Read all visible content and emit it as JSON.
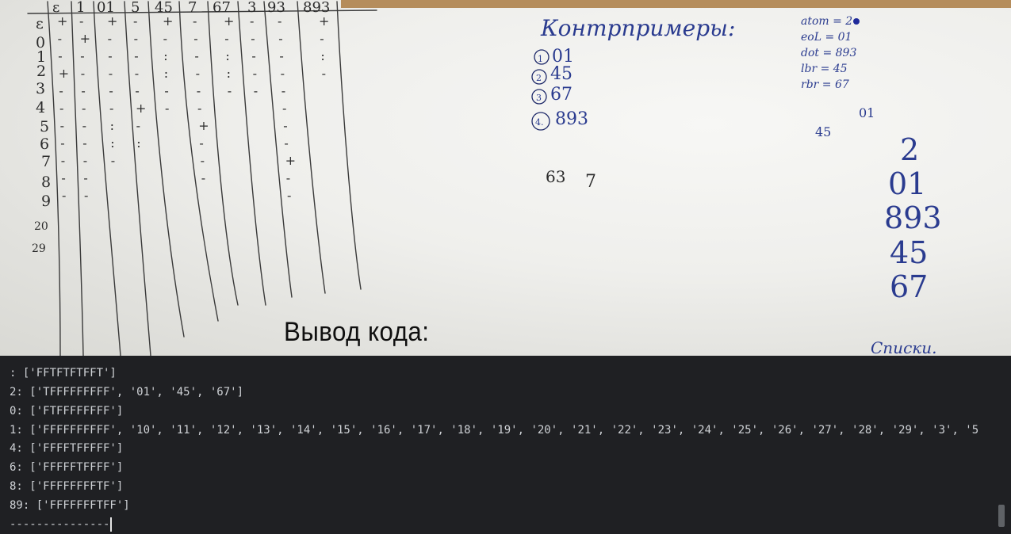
{
  "photo": {
    "caption": "Вывод кода:",
    "table_header": [
      "ε",
      "1",
      "01",
      "5",
      "45",
      "7",
      "67",
      "3",
      "93",
      "893"
    ],
    "row_labels": [
      "ε",
      "0",
      "1",
      "2",
      "3",
      "4",
      "5",
      "6",
      "7",
      "8",
      "9",
      "20",
      "29"
    ],
    "counterexamples_title": "Контрпримеры:",
    "counterexamples": [
      "1",
      "01",
      "2",
      "45",
      "3",
      "67",
      "4.",
      "893"
    ],
    "loose_text": [
      "63",
      "7"
    ],
    "legend": [
      "atom = 2",
      "eoL = 01",
      "dot = 893",
      "lbr = 45",
      "rbr = 67"
    ],
    "right_notes": [
      "01",
      "45"
    ],
    "big_column": [
      "2",
      "01",
      "893",
      "45",
      "67"
    ],
    "bottom_note": "Списки."
  },
  "terminal": {
    "lines": [
      ": ['FFTFTFTFFT']",
      "2: ['TFFFFFFFFF', '01', '45', '67']",
      "0: ['FTFFFFFFFF']",
      "1: ['FFFFFFFFFF', '10', '11', '12', '13', '14', '15', '16', '17', '18', '19', '20', '21', '22', '23', '24', '25', '26', '27', '28', '29', '3', '5",
      "4: ['FFFFTFFFFF']",
      "6: ['FFFFFTFFFF']",
      "8: ['FFFFFFFFTF']",
      "89: ['FFFFFFFTFF']",
      "---------------"
    ]
  }
}
